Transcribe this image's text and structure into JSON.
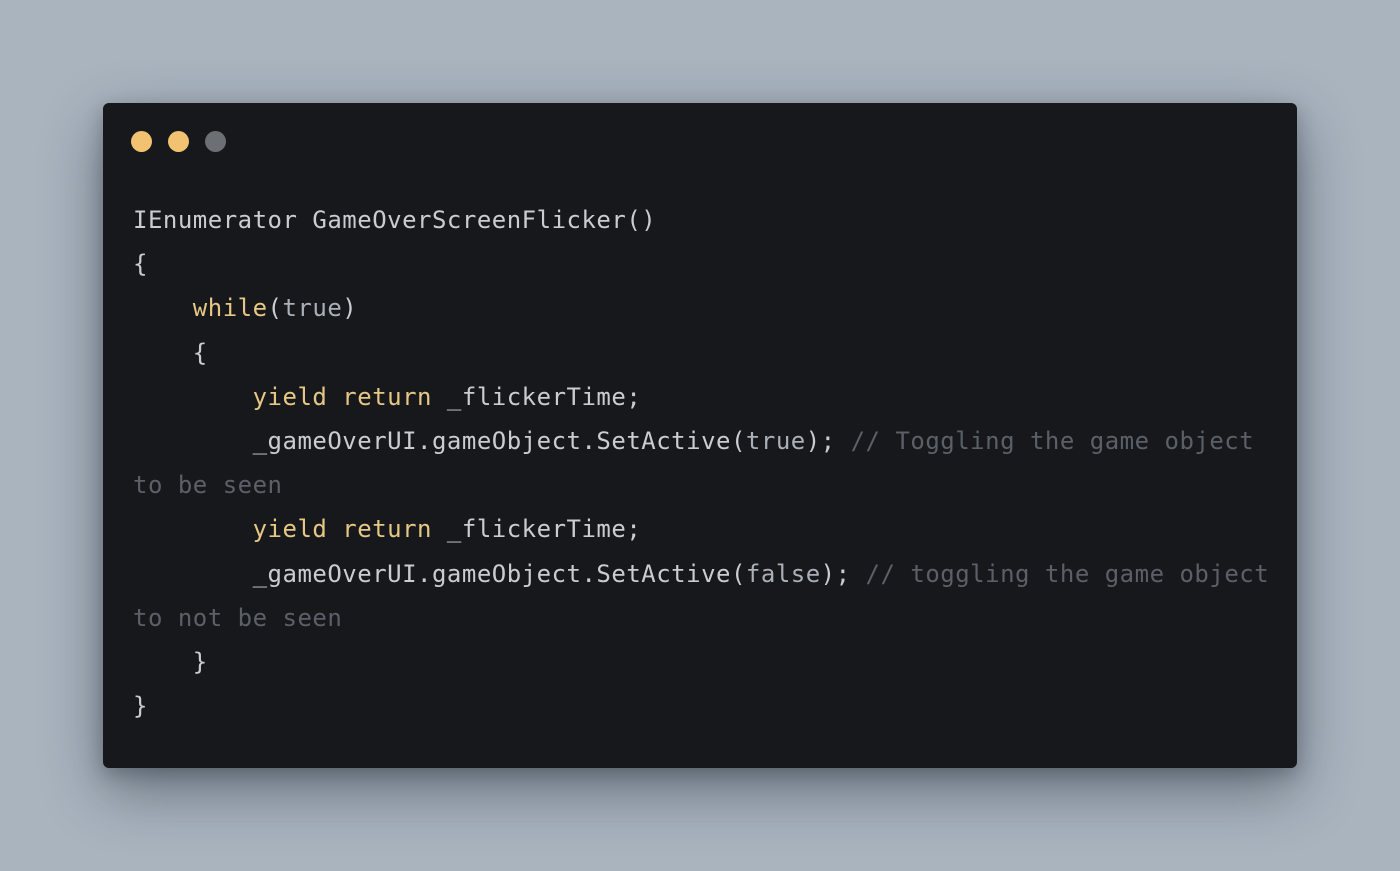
{
  "window": {
    "dots": [
      {
        "name": "dot-1",
        "color": "#f2c271"
      },
      {
        "name": "dot-2",
        "color": "#f2c271"
      },
      {
        "name": "dot-3",
        "color": "#6c7075"
      }
    ]
  },
  "code": {
    "lines": [
      [
        {
          "text": "IEnumerator GameOverScreenFlicker()",
          "kind": "plain"
        }
      ],
      [
        {
          "text": "{",
          "kind": "plain"
        }
      ],
      [
        {
          "text": "    ",
          "kind": "plain"
        },
        {
          "text": "while",
          "kind": "kw"
        },
        {
          "text": "(",
          "kind": "plain"
        },
        {
          "text": "true",
          "kind": "lit"
        },
        {
          "text": ")",
          "kind": "plain"
        }
      ],
      [
        {
          "text": "    {",
          "kind": "plain"
        }
      ],
      [
        {
          "text": "        ",
          "kind": "plain"
        },
        {
          "text": "yield return",
          "kind": "kw"
        },
        {
          "text": " _flickerTime;",
          "kind": "plain"
        }
      ],
      [
        {
          "text": "        _gameOverUI.gameObject.SetActive(",
          "kind": "plain"
        },
        {
          "text": "true",
          "kind": "lit"
        },
        {
          "text": "); ",
          "kind": "plain"
        },
        {
          "text": "// Toggling the game object",
          "kind": "cmt"
        }
      ],
      [
        {
          "text": "to be seen",
          "kind": "cmt"
        }
      ],
      [
        {
          "text": "        ",
          "kind": "plain"
        },
        {
          "text": "yield return",
          "kind": "kw"
        },
        {
          "text": " _flickerTime;",
          "kind": "plain"
        }
      ],
      [
        {
          "text": "        _gameOverUI.gameObject.SetActive(",
          "kind": "plain"
        },
        {
          "text": "false",
          "kind": "lit"
        },
        {
          "text": "); ",
          "kind": "plain"
        },
        {
          "text": "// toggling the game object",
          "kind": "cmt"
        }
      ],
      [
        {
          "text": "to not be seen",
          "kind": "cmt"
        }
      ],
      [
        {
          "text": "    }",
          "kind": "plain"
        }
      ],
      [
        {
          "text": "}",
          "kind": "plain"
        }
      ]
    ]
  }
}
